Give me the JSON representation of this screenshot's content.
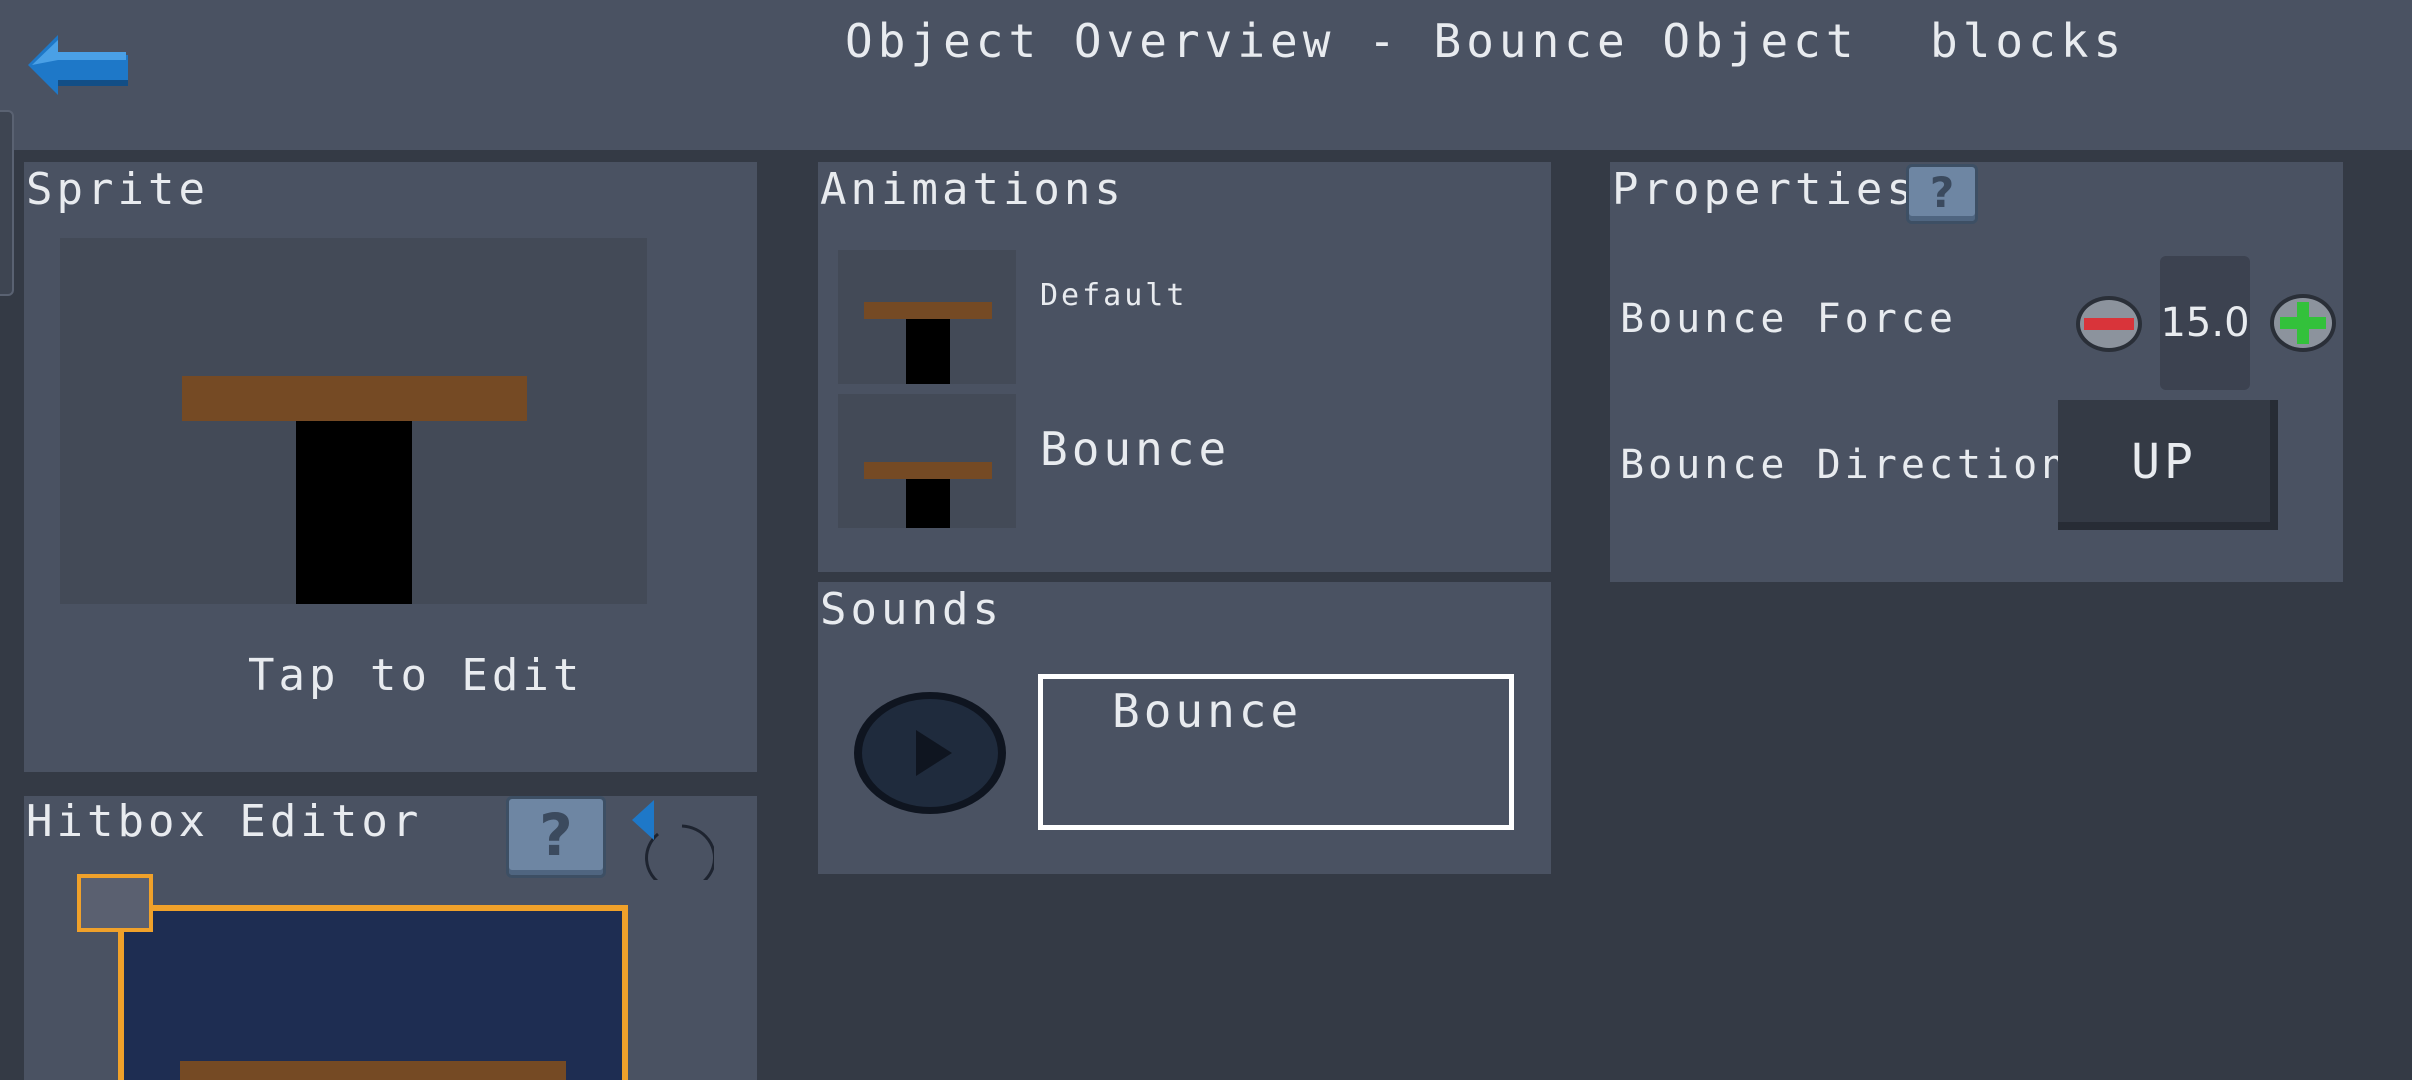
{
  "header": {
    "title": "Object Overview - Bounce Object",
    "category": "blocks"
  },
  "sprite": {
    "title": "Sprite",
    "edit_label": "Tap to Edit"
  },
  "hitbox": {
    "title": "Hitbox Editor",
    "help_label": "?"
  },
  "animations": {
    "title": "Animations",
    "items": [
      {
        "label": "Default"
      },
      {
        "label": "Bounce"
      }
    ]
  },
  "sounds": {
    "title": "Sounds",
    "selected": "Bounce"
  },
  "properties": {
    "title": "Properties",
    "help_label": "?",
    "bounce_force": {
      "label": "Bounce Force",
      "value": "15.0"
    },
    "bounce_direction": {
      "label": "Bounce Direction",
      "value": "UP"
    }
  },
  "colors": {
    "background": "#343a45",
    "panel": "#4a5262",
    "accent_blue": "#1e78c8",
    "hitbox_outline": "#f0a12a",
    "hitbox_fill": "#1e2d52",
    "sprite_wood": "#754a24",
    "minus_red": "#d9343a",
    "plus_green": "#33c13b"
  },
  "icons": {
    "back": "back-arrow-icon",
    "reset": "undo-icon",
    "play": "play-icon",
    "minus": "minus-icon",
    "plus": "plus-icon"
  }
}
